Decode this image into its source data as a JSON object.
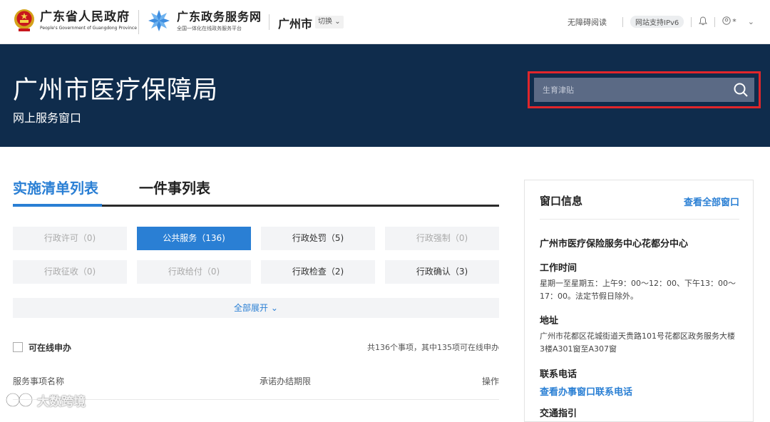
{
  "header": {
    "gov_name": "广东省人民政府",
    "gov_name_en": "People's Government of Guangdong Province",
    "service_name": "广东政务服务网",
    "service_sub": "全国一体化在线政务服务平台",
    "city": "广州市",
    "switch_label": "切换",
    "accessible_label": "无障碍阅读",
    "ipv6_label": "网站支持IPv6",
    "bell_icon": "bell-icon",
    "user_icon": "user-icon",
    "user_suffix": "*"
  },
  "banner": {
    "title": "广州市医疗保障局",
    "subtitle": "网上服务窗口",
    "search_placeholder": "生育津贴"
  },
  "tabs": {
    "active": "实施清单列表",
    "inactive": "一件事列表"
  },
  "categories": [
    {
      "label": "行政许可（0)",
      "state": "disabled"
    },
    {
      "label": "公共服务（136)",
      "state": "active"
    },
    {
      "label": "行政处罚（5)",
      "state": "normal"
    },
    {
      "label": "行政强制（0)",
      "state": "disabled"
    },
    {
      "label": "行政征收（0)",
      "state": "disabled"
    },
    {
      "label": "行政给付（0)",
      "state": "disabled"
    },
    {
      "label": "行政检查（2)",
      "state": "normal"
    },
    {
      "label": "行政确认（3)",
      "state": "normal"
    }
  ],
  "expand_label": "全部展开",
  "filter": {
    "online_label": "可在线申办",
    "count_text": "共136个事项，其中135项可在线申办"
  },
  "list_header": {
    "col_name": "服务事项名称",
    "col_limit": "承诺办结期限",
    "col_action": "操作"
  },
  "panel": {
    "title": "窗口信息",
    "view_all": "查看全部窗口",
    "center_name": "广州市医疗保险服务中心花都分中心",
    "hours_label": "工作时间",
    "hours_value": "星期一至星期五：上午9：00～12：00、下午13：00～17：00。法定节假日除外。",
    "address_label": "地址",
    "address_value": "广州市花都区花城街道天贵路101号花都区政务服务大楼3楼A301窗至A307窗",
    "phone_label": "联系电话",
    "phone_link": "查看办事窗口联系电话",
    "traffic_label": "交通指引"
  },
  "watermark": "大数跨境",
  "colors": {
    "banner_bg": "#0f2c4c",
    "accent": "#2a7fd4",
    "search_highlight": "#e0262b"
  }
}
